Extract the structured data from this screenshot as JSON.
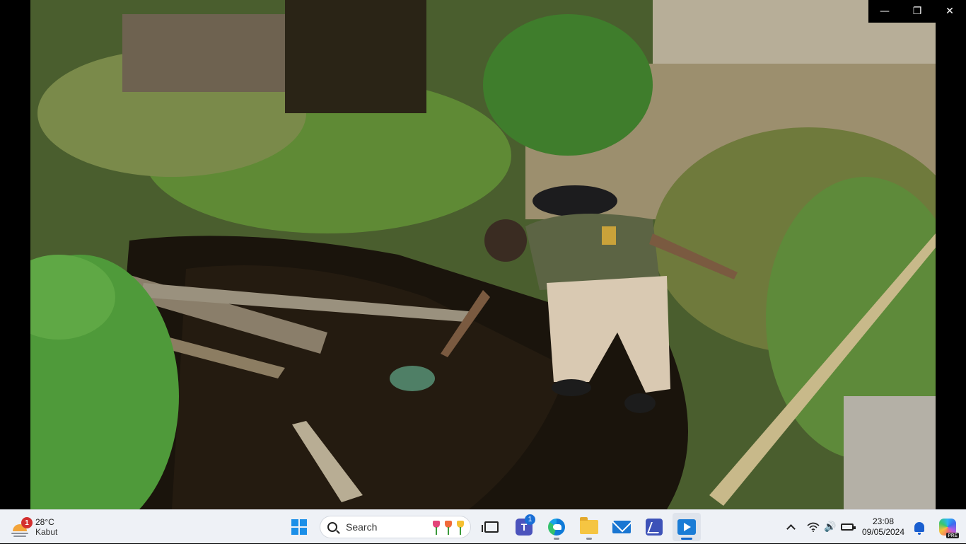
{
  "window": {
    "minimize_glyph": "—",
    "restore_glyph": "❐",
    "close_glyph": "✕"
  },
  "photo": {
    "description_icon": "photo-content"
  },
  "taskbar": {
    "weather": {
      "temperature": "28°C",
      "condition": "Kabut",
      "badge": "1",
      "icon": "fog-sun-icon"
    },
    "search": {
      "label": "Search"
    },
    "apps": [
      {
        "name": "start",
        "icon": "windows-logo-icon"
      },
      {
        "name": "task-view",
        "icon": "task-view-icon"
      },
      {
        "name": "teams",
        "icon": "teams-icon",
        "badge": "1",
        "letter": "T"
      },
      {
        "name": "edge",
        "icon": "edge-icon"
      },
      {
        "name": "file-explorer",
        "icon": "folder-icon"
      },
      {
        "name": "mail",
        "icon": "mail-icon"
      },
      {
        "name": "app",
        "icon": "app-icon"
      },
      {
        "name": "media-player",
        "icon": "media-player-icon"
      }
    ],
    "tray": {
      "clock_time": "23:08",
      "clock_date": "09/05/2024",
      "volume_glyph": "🔊",
      "copilot_badge": "PRE"
    }
  },
  "colors": {
    "taskbar_bg": "#eef1f6",
    "accent": "#1166cc"
  }
}
